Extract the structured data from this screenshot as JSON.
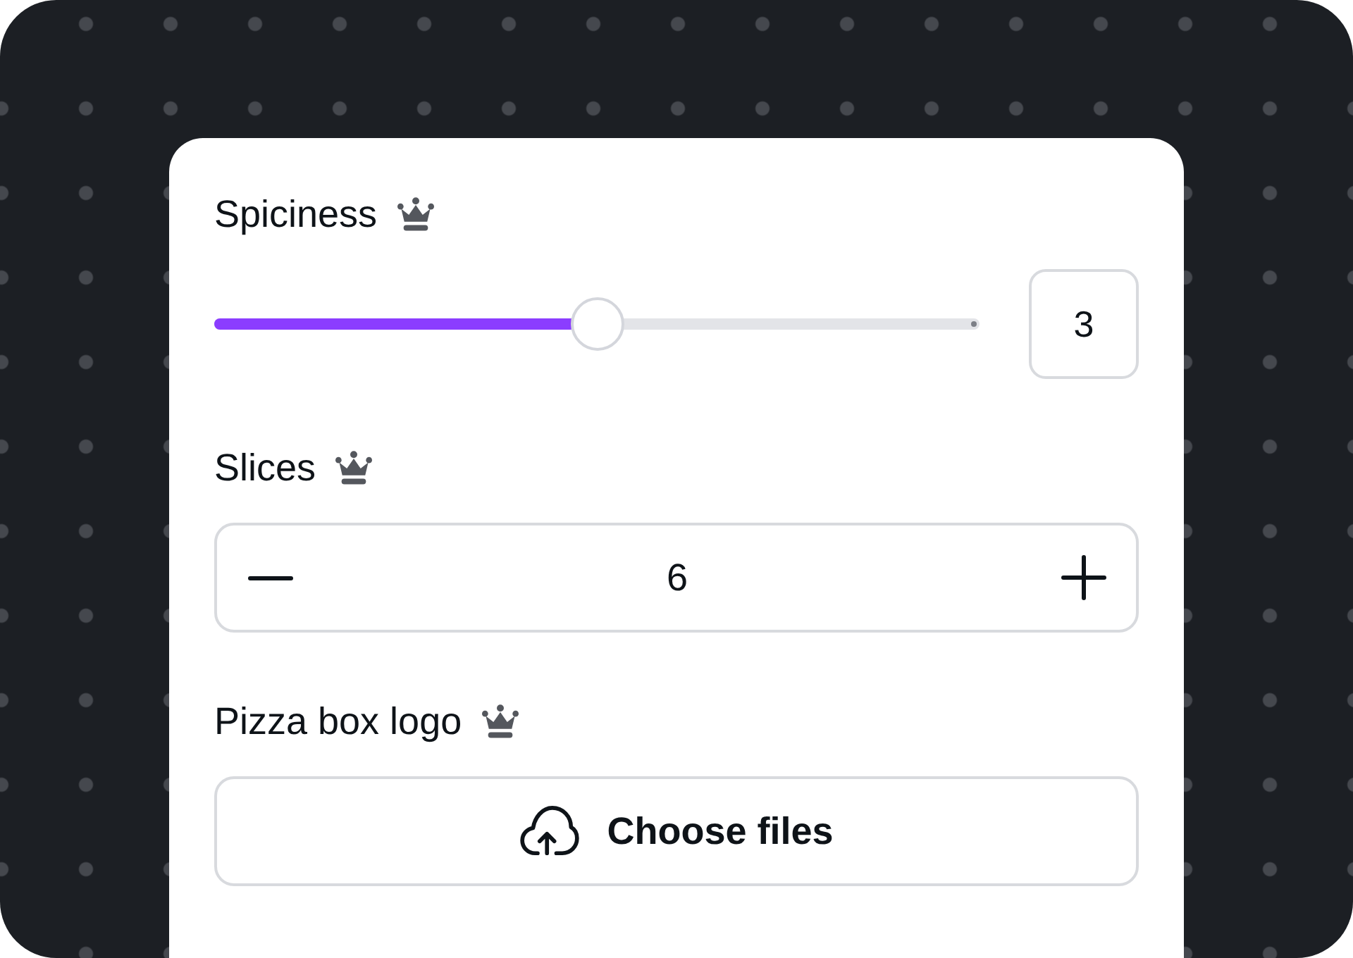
{
  "fields": [
    {
      "kind": "slider",
      "label": "Spiciness",
      "premium": true,
      "level": 0.5,
      "value": "3"
    },
    {
      "kind": "stepper",
      "label": "Slices",
      "premium": true,
      "value": "6"
    },
    {
      "kind": "upload",
      "label": "Pizza box logo",
      "premium": true,
      "button": "Choose files"
    }
  ]
}
